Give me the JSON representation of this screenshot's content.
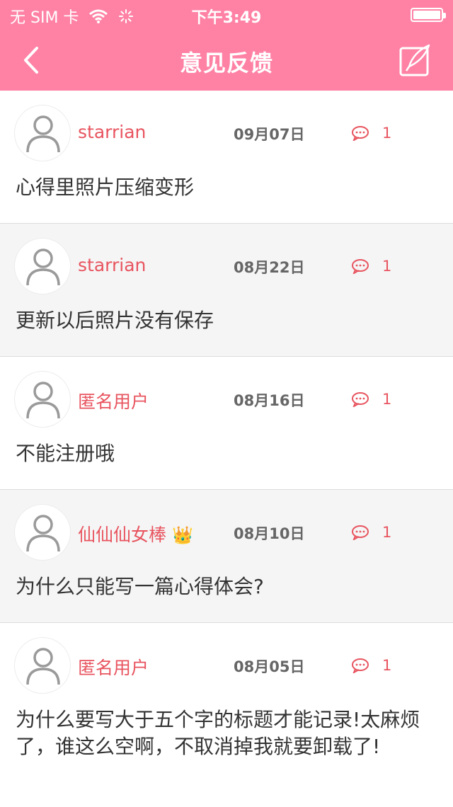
{
  "status": {
    "carrier": "无 SIM 卡",
    "time": "下午3:49",
    "battery_level": 1.0
  },
  "nav": {
    "title": "意见反馈",
    "back_icon": "chevron-left-icon",
    "edit_icon": "compose-icon"
  },
  "colors": {
    "header": "#ff82a5",
    "accent": "#e8545f",
    "alt_row": "#f5f5f5"
  },
  "feedback": [
    {
      "user": "starrian",
      "date": "09月07日",
      "comments": "1",
      "content": "心得里照片压缩变形",
      "vip": false
    },
    {
      "user": "starrian",
      "date": "08月22日",
      "comments": "1",
      "content": "更新以后照片没有保存",
      "vip": false
    },
    {
      "user": "匿名用户",
      "date": "08月16日",
      "comments": "1",
      "content": "不能注册哦",
      "vip": false
    },
    {
      "user": "仙仙仙女棒",
      "date": "08月10日",
      "comments": "1",
      "content": "为什么只能写一篇心得体会?",
      "vip": true,
      "badge": "👑"
    },
    {
      "user": "匿名用户",
      "date": "08月05日",
      "comments": "1",
      "content": "为什么要写大于五个字的标题才能记录!太麻烦了，谁这么空啊，不取消掉我就要卸载了!",
      "vip": false
    }
  ]
}
